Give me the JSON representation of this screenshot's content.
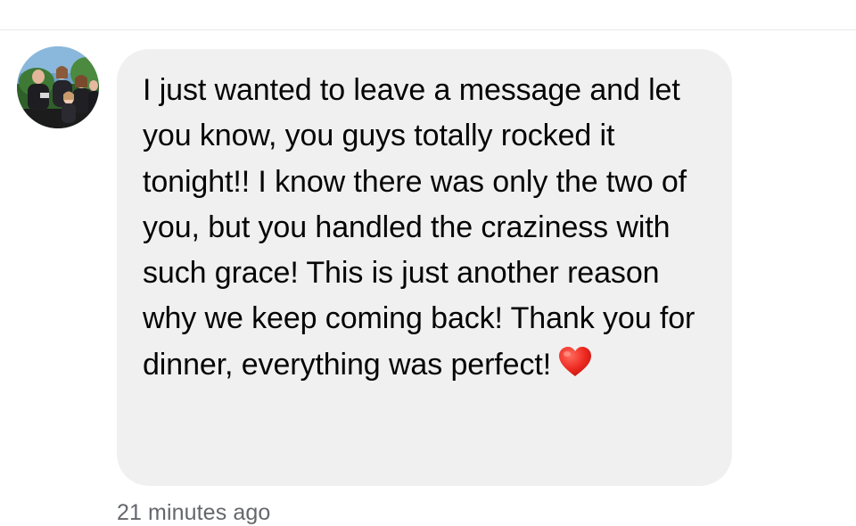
{
  "message": {
    "text": "I just wanted to leave a message and let you know, you guys totally rocked it tonight!! I know there was only the two of you, but you handled the craziness with such grace! This is just another reason why we keep coming back! Thank you for dinner, everything was perfect!",
    "emoji_icon": "red-heart-icon",
    "bubble_color": "#f0f0f0",
    "text_color": "#050505"
  },
  "meta": {
    "timestamp": "21 minutes ago",
    "timestamp_color": "#65676b"
  },
  "avatar": {
    "icon": "profile-photo-avatar"
  }
}
